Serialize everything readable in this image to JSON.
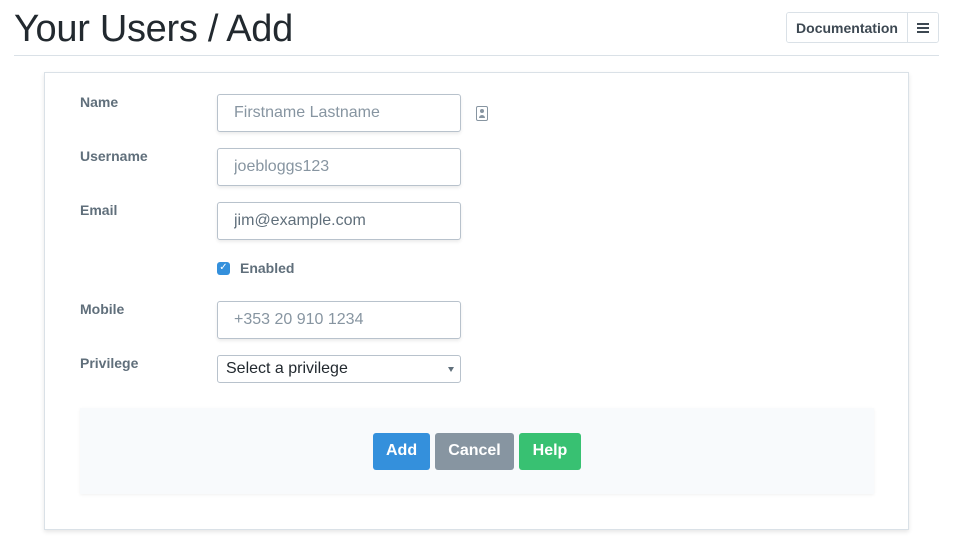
{
  "header": {
    "title": "Your Users / Add",
    "documentation_label": "Documentation",
    "list_icon": "list-icon"
  },
  "form": {
    "name": {
      "label": "Name",
      "placeholder": "Firstname Lastname",
      "icon": "contact-card-icon"
    },
    "username": {
      "label": "Username",
      "placeholder": "joebloggs123"
    },
    "email": {
      "label": "Email",
      "value": "jim@example.com"
    },
    "enabled": {
      "label": "Enabled",
      "checked": true
    },
    "mobile": {
      "label": "Mobile",
      "placeholder": "+353 20 910 1234"
    },
    "privilege": {
      "label": "Privilege",
      "selected": "Select a privilege"
    }
  },
  "actions": {
    "add_label": "Add",
    "cancel_label": "Cancel",
    "help_label": "Help"
  },
  "colors": {
    "primary": "#3490dc",
    "secondary": "#8795a1",
    "success": "#38c172"
  }
}
